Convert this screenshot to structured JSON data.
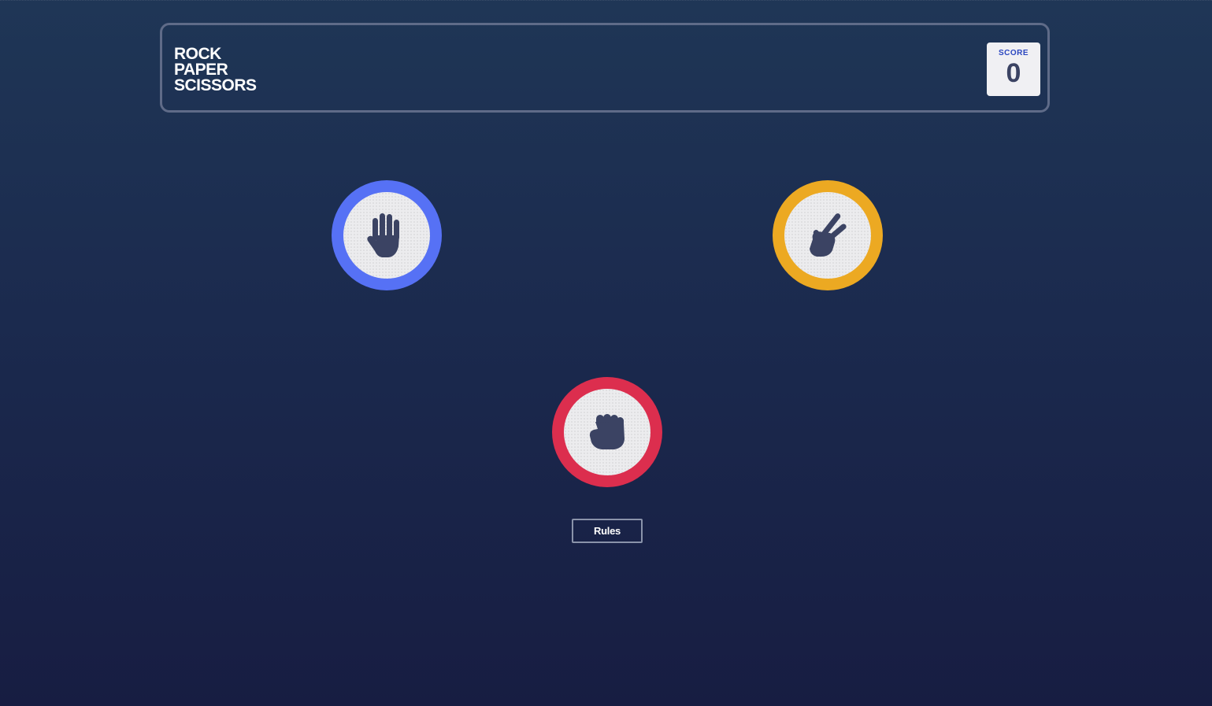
{
  "header": {
    "title_lines": [
      "ROCK",
      "PAPER",
      "SCISSORS"
    ],
    "score_label": "SCORE",
    "score_value": "0"
  },
  "tokens": [
    {
      "name": "paper",
      "icon": "paper-hand-icon",
      "color": "#5671f5"
    },
    {
      "name": "scissors",
      "icon": "scissors-hand-icon",
      "color": "#eca922"
    },
    {
      "name": "rock",
      "icon": "rock-fist-icon",
      "color": "#dc2e4e"
    }
  ],
  "rules_button": {
    "label": "Rules"
  },
  "colors": {
    "background_top": "#1f3656",
    "background_bottom": "#171d42",
    "header_border": "#5f6b88",
    "icon": "#3b4363"
  }
}
